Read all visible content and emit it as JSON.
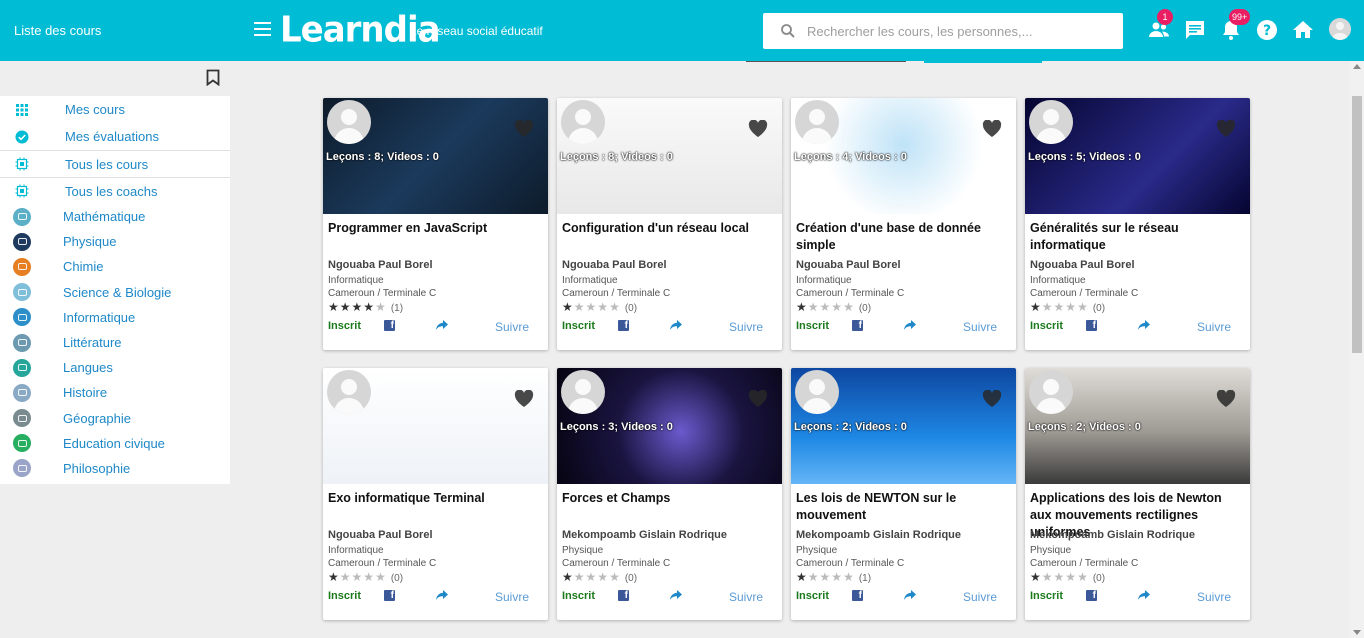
{
  "header": {
    "title": "Liste des cours",
    "logo": "Learndia",
    "tagline": "Le réseau social éducatif",
    "search_placeholder": "Rechercher les cours, les personnes,...",
    "friends_badge": "1",
    "notif_badge": "99+",
    "icons": [
      "menu-icon",
      "search-icon",
      "friends-icon",
      "chat-icon",
      "bell-icon",
      "help-icon",
      "home-icon",
      "avatar"
    ],
    "accent": "#00bcd4"
  },
  "sidebar": {
    "top_items": [
      {
        "label": "Mes cours",
        "icon": "grid-icon"
      },
      {
        "label": "Mes évaluations",
        "icon": "check-circle-icon"
      },
      {
        "label": "Tous les cours",
        "icon": "chip-icon"
      },
      {
        "label": "Tous les coachs",
        "icon": "chip-icon"
      }
    ],
    "subjects": [
      {
        "label": "Mathématique",
        "color": "#5bb0c8"
      },
      {
        "label": "Physique",
        "color": "#1e3a5f"
      },
      {
        "label": "Chimie",
        "color": "#e67e22"
      },
      {
        "label": "Science & Biologie",
        "color": "#7fbfd9"
      },
      {
        "label": "Informatique",
        "color": "#2c8fc9"
      },
      {
        "label": "Littérature",
        "color": "#6d9ab0"
      },
      {
        "label": "Langues",
        "color": "#26a69a"
      },
      {
        "label": "Histoire",
        "color": "#8aa9c4"
      },
      {
        "label": "Géographie",
        "color": "#7a8b8f"
      },
      {
        "label": "Education civique",
        "color": "#27ae60"
      },
      {
        "label": "Philosophie",
        "color": "#9aa4c8"
      }
    ]
  },
  "courses": [
    {
      "title": "Programmer en JavaScript",
      "lessons": "Leçons : 8; Videos : 0",
      "author": "Ngouaba Paul Borel",
      "subject": "Informatique",
      "location": "Cameroun / Terminale C",
      "stars": 4,
      "reviews": "(1)",
      "status": "Inscrit",
      "follow": "Suivre",
      "bg": "#15243a"
    },
    {
      "title": "Configuration d'un réseau local",
      "lessons": "Leçons : 8; Videos : 0",
      "author": "Ngouaba Paul Borel",
      "subject": "Informatique",
      "location": "Cameroun / Terminale C",
      "stars": 1,
      "reviews": "(0)",
      "status": "Inscrit",
      "follow": "Suivre",
      "bg": "#f1f1f1"
    },
    {
      "title": "Création d'une base de donnée simple",
      "lessons": "Leçons : 4; Videos : 0",
      "author": "Ngouaba Paul Borel",
      "subject": "Informatique",
      "location": "Cameroun / Terminale C",
      "stars": 1,
      "reviews": "(0)",
      "status": "Inscrit",
      "follow": "Suivre",
      "bg": "#ffffff"
    },
    {
      "title": "Généralités sur le réseau informatique",
      "lessons": "Leçons : 5; Videos : 0",
      "author": "Ngouaba Paul Borel",
      "subject": "Informatique",
      "location": "Cameroun / Terminale C",
      "stars": 1,
      "reviews": "(0)",
      "status": "Inscrit",
      "follow": "Suivre",
      "bg": "#0a0a3a"
    },
    {
      "title": "Exo informatique Terminal",
      "lessons": "",
      "author": "Ngouaba Paul Borel",
      "subject": "Informatique",
      "location": "Cameroun / Terminale C",
      "stars": 1,
      "reviews": "(0)",
      "status": "Inscrit",
      "follow": "Suivre",
      "bg": "#f7f7f7"
    },
    {
      "title": "Forces et Champs",
      "lessons": "Leçons : 3; Videos : 0",
      "author": "Mekompoamb Gislain Rodrique",
      "subject": "Physique",
      "location": "Cameroun / Terminale C",
      "stars": 1,
      "reviews": "(0)",
      "status": "Inscrit",
      "follow": "Suivre",
      "bg": "#1a1440"
    },
    {
      "title": "Les lois de NEWTON sur le mouvement",
      "lessons": "Leçons : 2; Videos : 0",
      "author": "Mekompoamb Gislain Rodrique",
      "subject": "Physique",
      "location": "Cameroun / Terminale C",
      "stars": 1,
      "reviews": "(1)",
      "status": "Inscrit",
      "follow": "Suivre",
      "bg": "#1565c0"
    },
    {
      "title": "Applications des lois de Newton aux mouvements rectilignes uniformes",
      "lessons": "Leçons : 2; Videos : 0",
      "author": "Mekompoamb Gislain Rodrique",
      "subject": "Physique",
      "location": "Cameroun / Terminale C",
      "stars": 1,
      "reviews": "(0)",
      "status": "Inscrit",
      "follow": "Suivre",
      "bg": "#9e9a94"
    }
  ]
}
